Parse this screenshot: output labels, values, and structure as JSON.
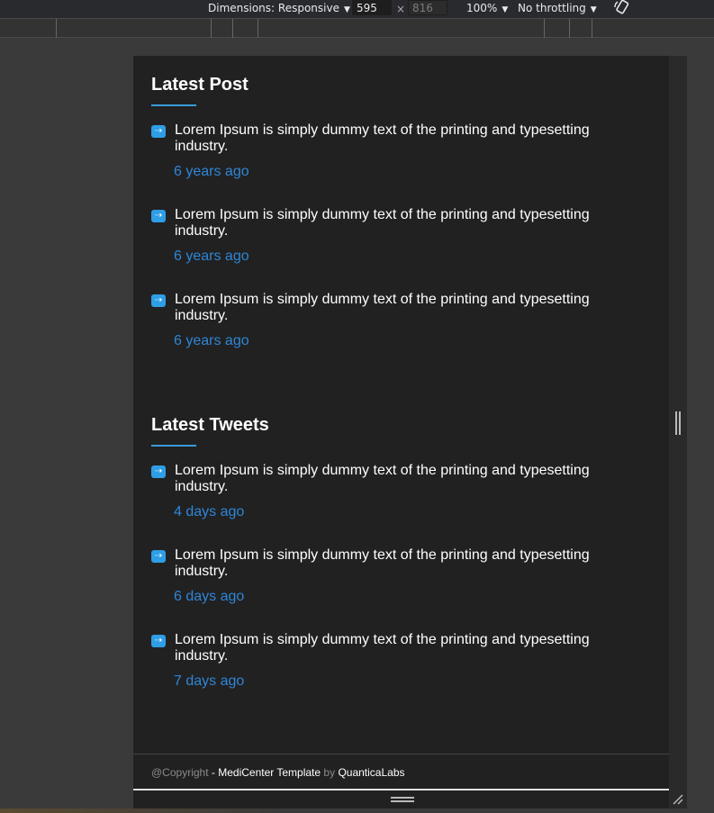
{
  "devtools": {
    "dimensions_label": "Dimensions: Responsive",
    "width_value": "595",
    "times_symbol": "×",
    "height_value": "816",
    "zoom_label": "100%",
    "throttling_label": "No throttling",
    "caret": "▼"
  },
  "latest_post": {
    "title": "Latest Post",
    "items": [
      {
        "text": "Lorem Ipsum is simply dummy text of the printing and typesetting industry.",
        "time": "6 years ago"
      },
      {
        "text": "Lorem Ipsum is simply dummy text of the printing and typesetting industry.",
        "time": "6 years ago"
      },
      {
        "text": "Lorem Ipsum is simply dummy text of the printing and typesetting industry.",
        "time": "6 years ago"
      }
    ]
  },
  "latest_tweets": {
    "title": "Latest Tweets",
    "items": [
      {
        "text": "Lorem Ipsum is simply dummy text of the printing and typesetting industry.",
        "time": "4 days ago"
      },
      {
        "text": "Lorem Ipsum is simply dummy text of the printing and typesetting industry.",
        "time": "6 days ago"
      },
      {
        "text": "Lorem Ipsum is simply dummy text of the printing and typesetting industry.",
        "time": "7 days ago"
      }
    ]
  },
  "footer": {
    "copyright": "@Copyright",
    "template": "- MediCenter Template",
    "by": "by",
    "company": "QuanticaLabs"
  },
  "icons": {
    "post_icon": "arrow-right-icon",
    "rotate_icon": "rotate-device-icon"
  },
  "colors": {
    "accent": "#3a9bdc",
    "link": "#2f86d6",
    "page_bg": "#212122"
  }
}
